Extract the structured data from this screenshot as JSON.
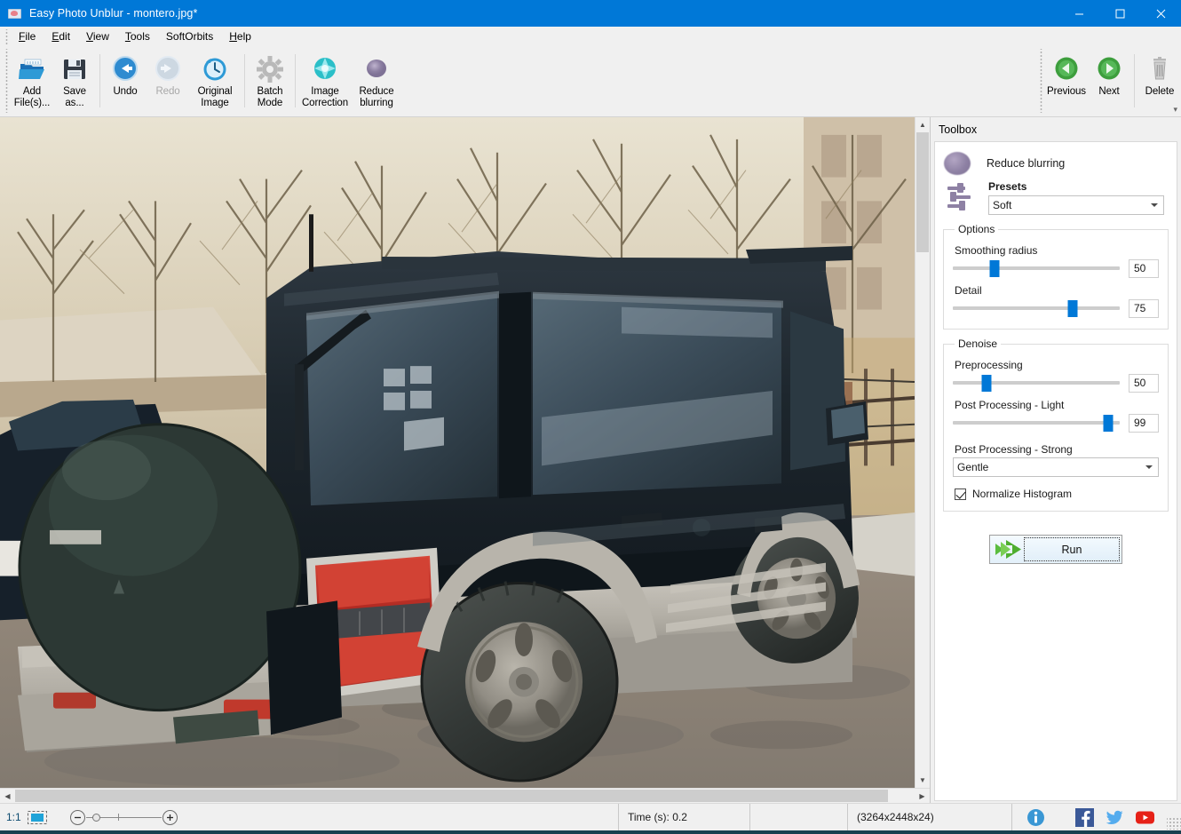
{
  "window": {
    "title": "Easy Photo Unblur - montero.jpg*",
    "app_icon": "photo-app-icon",
    "controls": {
      "minimize": "minimize-icon",
      "maximize": "maximize-icon",
      "close": "close-icon"
    },
    "titlebar_color": "#0078d7"
  },
  "menubar": {
    "items": [
      {
        "label": "File",
        "mnemonic": "F"
      },
      {
        "label": "Edit",
        "mnemonic": "E"
      },
      {
        "label": "View",
        "mnemonic": "V"
      },
      {
        "label": "Tools",
        "mnemonic": "T"
      },
      {
        "label": "SoftOrbits",
        "mnemonic": ""
      },
      {
        "label": "Help",
        "mnemonic": "H"
      }
    ]
  },
  "toolbar": {
    "left_buttons": [
      {
        "label": "Add\nFile(s)...",
        "icon": "open-folder-icon",
        "enabled": true
      },
      {
        "label": "Save\nas...",
        "icon": "floppy-disk-icon",
        "enabled": true
      },
      {
        "label": "Undo",
        "icon": "undo-arrow-icon",
        "enabled": true
      },
      {
        "label": "Redo",
        "icon": "redo-arrow-icon",
        "enabled": false
      },
      {
        "label": "Original\nImage",
        "icon": "clock-history-icon",
        "enabled": true
      },
      {
        "label": "Batch\nMode",
        "icon": "gear-icon",
        "enabled": true
      },
      {
        "label": "Image\nCorrection",
        "icon": "teal-starburst-icon",
        "enabled": true
      },
      {
        "label": "Reduce\nblurring",
        "icon": "purple-blur-icon",
        "enabled": true
      }
    ],
    "right_buttons": [
      {
        "label": "Previous",
        "icon": "green-left-arrow-icon",
        "enabled": true
      },
      {
        "label": "Next",
        "icon": "green-right-arrow-icon",
        "enabled": true
      },
      {
        "label": "Delete",
        "icon": "trash-can-icon",
        "enabled": true
      }
    ],
    "overflow": "▾"
  },
  "toolbox": {
    "panel_title": "Toolbox",
    "tool_name": "Reduce blurring",
    "tool_icon": "purple-blur-icon",
    "presets": {
      "label": "Presets",
      "icon": "sliders-preset-icon",
      "selected": "Soft",
      "options": [
        "Soft"
      ]
    },
    "options": {
      "legend": "Options",
      "sliders": [
        {
          "label": "Smoothing radius",
          "value": "50",
          "percent": 25
        },
        {
          "label": "Detail",
          "value": "75",
          "percent": 72
        }
      ]
    },
    "denoise": {
      "legend": "Denoise",
      "sliders": [
        {
          "label": "Preprocessing",
          "value": "50",
          "percent": 20
        },
        {
          "label": "Post Processing - Light",
          "value": "99",
          "percent": 93
        }
      ],
      "strong": {
        "label": "Post Processing - Strong",
        "selected": "Gentle",
        "options": [
          "Gentle"
        ]
      },
      "checkbox": {
        "label": "Normalize Histogram",
        "checked": true
      }
    },
    "run": {
      "label": "Run",
      "icon": "green-run-arrow-icon"
    }
  },
  "statusbar": {
    "zoom_ratio": "1:1",
    "fit_icon": "fit-to-window-icon",
    "zoom_out_icon": "minus-icon",
    "zoom_in_icon": "plus-icon",
    "time": "Time (s): 0.2",
    "dimensions": "(3264x2448x24)",
    "social": [
      {
        "name": "info-icon",
        "color": "#3a97d4"
      },
      {
        "name": "facebook-icon",
        "color": "#3b5998"
      },
      {
        "name": "twitter-icon",
        "color": "#55acee"
      },
      {
        "name": "youtube-icon",
        "color": "#e62117"
      }
    ]
  },
  "image": {
    "description": "Dark green Mitsubishi Montero SUV rear three-quarter view with spare tire cover, parked on gravel ground with bare trees and a metal fence in the background",
    "scrollbars": {
      "vertical": "vertical-scrollbar",
      "horizontal": "horizontal-scrollbar"
    }
  }
}
